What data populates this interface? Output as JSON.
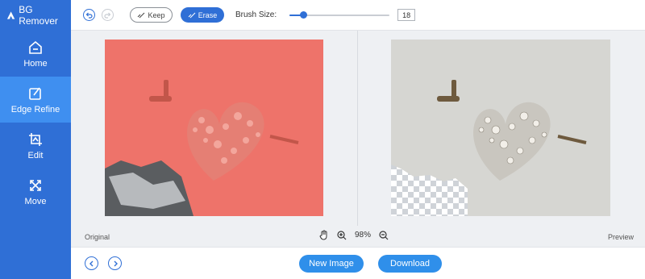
{
  "app": {
    "title": "BG Remover"
  },
  "sidebar": {
    "items": [
      {
        "label": "Home",
        "icon": "home-icon"
      },
      {
        "label": "Edge Refine",
        "icon": "edit-square-icon",
        "active": true
      },
      {
        "label": "Edit",
        "icon": "image-crop-icon"
      },
      {
        "label": "Move",
        "icon": "move-arrows-icon"
      }
    ]
  },
  "toolbar": {
    "keep_label": "Keep",
    "erase_label": "Erase",
    "brush_label": "Brush Size:",
    "brush_size": "18",
    "brush_level": 0.14
  },
  "status": {
    "original_label": "Original",
    "preview_label": "Preview",
    "zoom": "98%"
  },
  "bottom": {
    "new_image_label": "New Image",
    "download_label": "Download"
  },
  "colors": {
    "sidebar": "#2f6fd6",
    "accent": "#2f6fd6",
    "button": "#2f8fea",
    "overlay": "#f0645a"
  }
}
